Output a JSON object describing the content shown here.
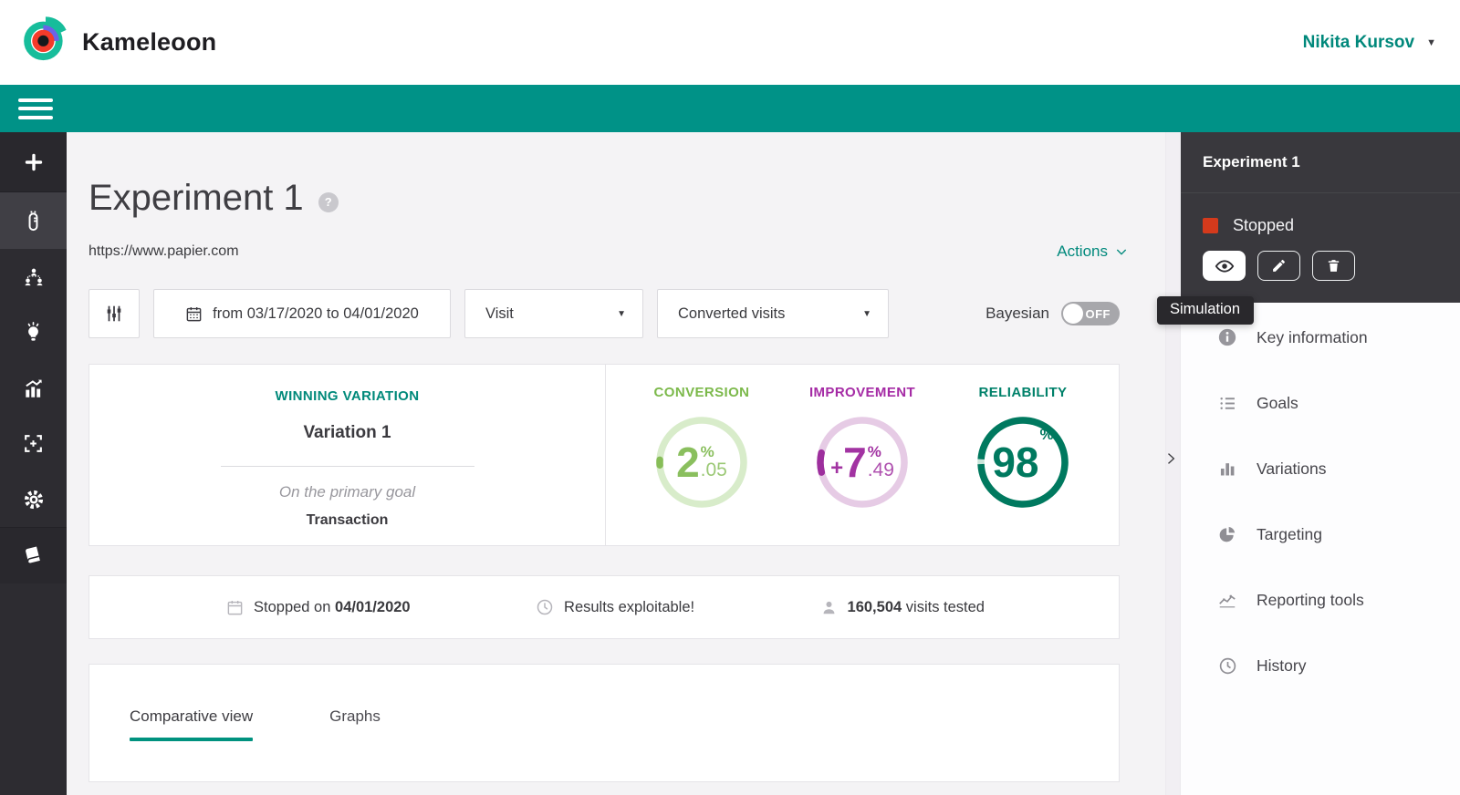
{
  "header": {
    "brand": "Kameleoon",
    "user": "Nikita Kursov"
  },
  "page": {
    "title": "Experiment 1",
    "help_badge": "?",
    "url": "https://www.papier.com",
    "actions": "Actions"
  },
  "filters": {
    "date_range": "from 03/17/2020 to 04/01/2020",
    "visit": "Visit",
    "goal": "Converted visits",
    "bayesian_label": "Bayesian",
    "bayesian_state": "OFF"
  },
  "winning": {
    "heading": "WINNING VARIATION",
    "name": "Variation 1",
    "subtitle": "On the primary goal",
    "goal": "Transaction"
  },
  "gauges": {
    "conversion": {
      "label": "CONVERSION",
      "int": "2",
      "pct": "%",
      "dec": ".05"
    },
    "improvement": {
      "label": "IMPROVEMENT",
      "sign": "+",
      "int": "7",
      "pct": "%",
      "dec": ".49"
    },
    "reliability": {
      "label": "RELIABILITY",
      "int": "98",
      "pct": "%"
    }
  },
  "chart_data": [
    {
      "type": "donut-gauge",
      "title": "CONVERSION",
      "value": 2.05,
      "unit": "%",
      "color": "#87bd58"
    },
    {
      "type": "donut-gauge",
      "title": "IMPROVEMENT",
      "value": 7.49,
      "unit": "%",
      "sign": "+",
      "color": "#9d2f9d"
    },
    {
      "type": "donut-gauge",
      "title": "RELIABILITY",
      "value": 98,
      "unit": "%",
      "color": "#00795f"
    }
  ],
  "status_bar": {
    "stopped_prefix": "Stopped on",
    "stopped_date": "04/01/2020",
    "results_text": "Results exploitable!",
    "visits_count": "160,504",
    "visits_suffix": "visits tested"
  },
  "tabs": [
    {
      "label": "Comparative view",
      "active": true
    },
    {
      "label": "Graphs",
      "active": false
    }
  ],
  "panel": {
    "title": "Experiment 1",
    "status": "Stopped",
    "tooltip": "Simulation",
    "menu": [
      {
        "icon": "info-icon",
        "label": "Key information"
      },
      {
        "icon": "list-icon",
        "label": "Goals"
      },
      {
        "icon": "bar-chart-icon",
        "label": "Variations"
      },
      {
        "icon": "pie-chart-icon",
        "label": "Targeting"
      },
      {
        "icon": "line-chart-icon",
        "label": "Reporting tools"
      },
      {
        "icon": "clock-icon",
        "label": "History"
      }
    ]
  },
  "rail_icons": [
    {
      "icon": "plus-icon"
    },
    {
      "icon": "experiments-icon",
      "active": true
    },
    {
      "icon": "audiences-icon"
    },
    {
      "icon": "ideas-icon"
    },
    {
      "icon": "analytics-icon"
    },
    {
      "icon": "personalization-icon"
    },
    {
      "icon": "settings-icon"
    },
    {
      "icon": "docs-icon"
    }
  ],
  "colors": {
    "nav_teal": "#009287",
    "accent_teal": "#00897c",
    "green": "#87bd58",
    "magenta": "#9d2f9d",
    "dark_green": "#00795f",
    "status_red": "#d43a1c"
  }
}
